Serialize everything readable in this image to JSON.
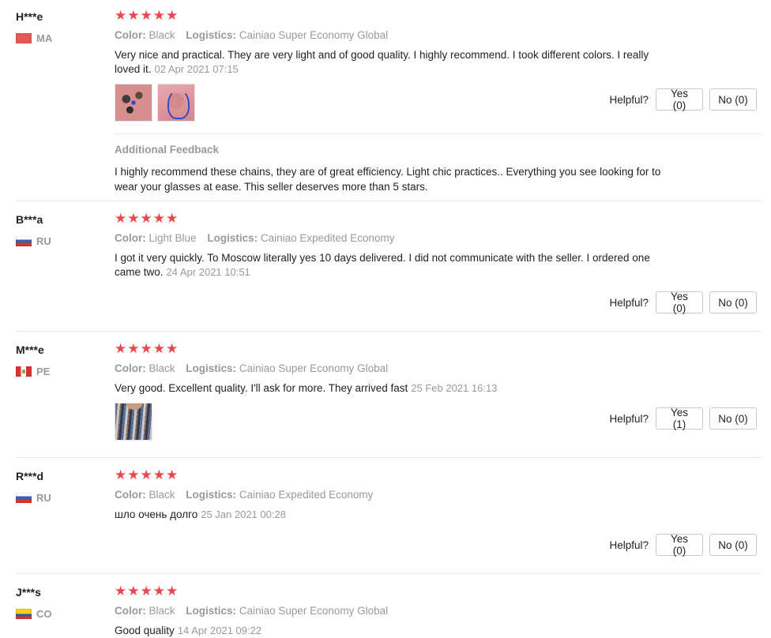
{
  "labels": {
    "color": "Color:",
    "logistics": "Logistics:",
    "helpful": "Helpful?",
    "additional_feedback": "Additional Feedback"
  },
  "reviews": [
    {
      "name": "H***e",
      "country": "MA",
      "rating": 5,
      "color": "Black",
      "logistics": "Cainiao Super Economy Global",
      "text": "Very nice and practical. They are very light and of good quality. I highly recommend. I took different colors. I really loved it.",
      "date": "02 Apr 2021 07:15",
      "yes": "Yes (0)",
      "no": "No (0)",
      "additional_feedback": "I highly recommend these chains, they are of great efficiency. Light chic practices.. Everything you see looking for to wear your glasses at ease. This seller deserves more than 5 stars."
    },
    {
      "name": "B***a",
      "country": "RU",
      "rating": 5,
      "color": "Light Blue",
      "logistics": "Cainiao Expedited Economy",
      "text": "I got it very quickly. To Moscow literally yes 10 days delivered. I did not communicate with the seller. I ordered one came two.",
      "date": "24 Apr 2021 10:51",
      "yes": "Yes (0)",
      "no": "No (0)"
    },
    {
      "name": "M***e",
      "country": "PE",
      "rating": 5,
      "color": "Black",
      "logistics": "Cainiao Super Economy Global",
      "text": "Very good. Excellent quality. I'll ask for more. They arrived fast",
      "date": "25 Feb 2021 16:13",
      "yes": "Yes (1)",
      "no": "No (0)"
    },
    {
      "name": "R***d",
      "country": "RU",
      "rating": 5,
      "color": "Black",
      "logistics": "Cainiao Expedited Economy",
      "text": "шло очень долго",
      "date": "25 Jan 2021 00:28",
      "yes": "Yes (0)",
      "no": "No (0)"
    },
    {
      "name": "J***s",
      "country": "CO",
      "rating": 5,
      "color": "Black",
      "logistics": "Cainiao Super Economy Global",
      "text": "Good quality",
      "date": "14 Apr 2021 09:22"
    }
  ]
}
